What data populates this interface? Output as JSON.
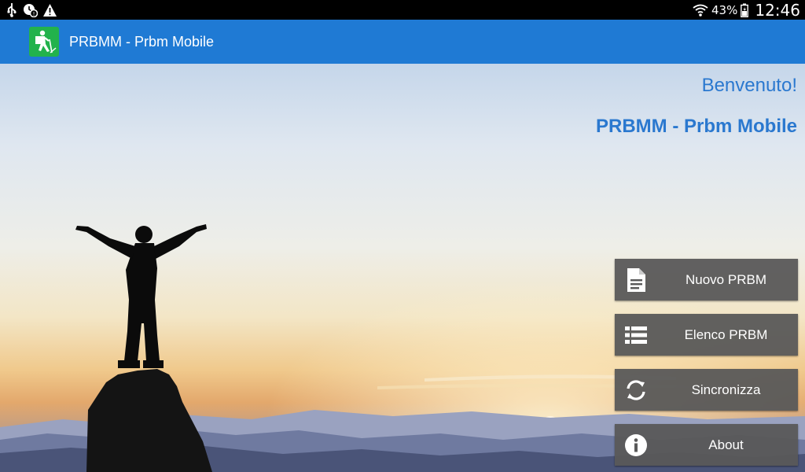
{
  "status_bar": {
    "battery_percent": "43%",
    "time": "12:46"
  },
  "action_bar": {
    "title": "PRBMM - Prbm Mobile",
    "color": "#1f7ad4"
  },
  "main": {
    "welcome": "Benvenuto!",
    "app_name": "PRBMM - Prbm Mobile",
    "accent_color": "#2a78cf"
  },
  "menu": [
    {
      "label": "Nuovo PRBM",
      "icon": "document-icon"
    },
    {
      "label": "Elenco PRBM",
      "icon": "list-icon"
    },
    {
      "label": "Sincronizza",
      "icon": "sync-icon"
    },
    {
      "label": "About",
      "icon": "info-icon"
    }
  ]
}
